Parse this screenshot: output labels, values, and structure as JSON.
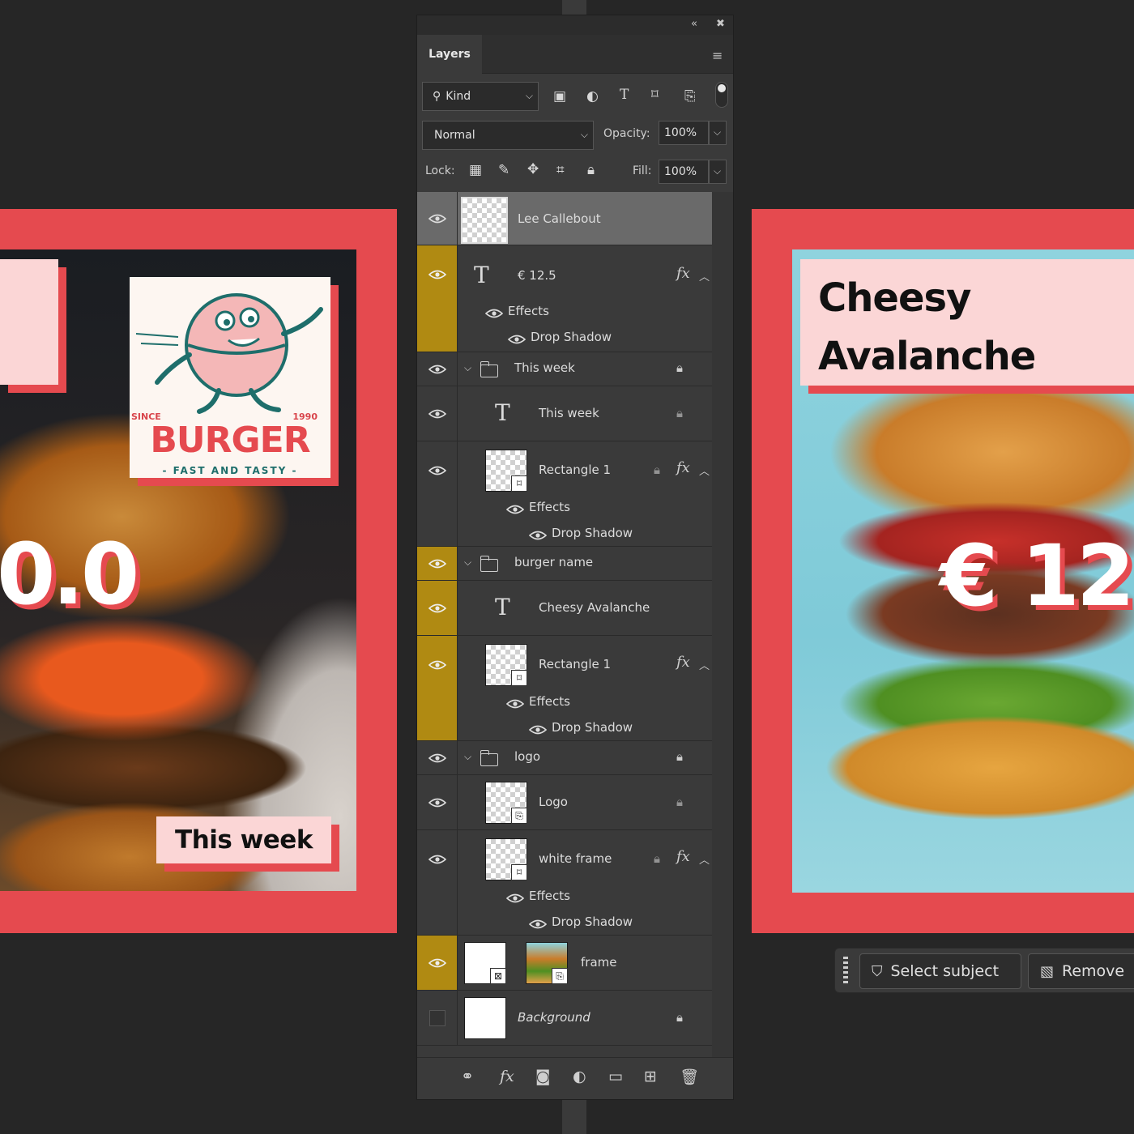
{
  "canvas": {
    "left_artboard": {
      "price_text": "0.0",
      "this_week_label": "This week",
      "logo": {
        "since": "SINCE",
        "year": "1990",
        "title": "BURGER",
        "tagline": "- FAST AND TASTY -"
      }
    },
    "right_artboard": {
      "title_line1": "Cheesy",
      "title_line2": "Avalanche",
      "price_text": "€ 12"
    },
    "colors": {
      "frame_red": "#e54a4f",
      "card_pink": "#fbd6d6",
      "teal_bg": "#8fd3de"
    }
  },
  "panel": {
    "tab_label": "Layers",
    "filter": {
      "value": "Kind"
    },
    "blend_mode": "Normal",
    "opacity_label": "Opacity:",
    "opacity_value": "100%",
    "lock_label": "Lock:",
    "fill_label": "Fill:",
    "fill_value": "100%",
    "filter_icons": [
      "image-filter-icon",
      "adjustment-filter-icon",
      "type-filter-icon",
      "shape-filter-icon",
      "smart-object-filter-icon"
    ],
    "lock_icons": [
      "lock-transparent-icon",
      "lock-paint-icon",
      "lock-position-icon",
      "lock-artboard-icon",
      "lock-all-icon"
    ],
    "layers": {
      "lee_callebout": "Lee Callebout",
      "price": "€ 12.5",
      "price_effects": "Effects",
      "price_drop_shadow": "Drop Shadow",
      "group_this_week": "This week",
      "text_this_week": "This week",
      "rect1_a": "Rectangle 1",
      "rect1_a_effects": "Effects",
      "rect1_a_drop_shadow": "Drop Shadow",
      "group_burger_name": "burger name",
      "text_cheesy": "Cheesy Avalanche",
      "rect1_b": "Rectangle 1",
      "rect1_b_effects": "Effects",
      "rect1_b_drop_shadow": "Drop Shadow",
      "group_logo": "logo",
      "logo": "Logo",
      "white_frame": "white frame",
      "white_frame_effects": "Effects",
      "white_frame_drop_shadow": "Drop Shadow",
      "frame": "frame",
      "background": "Background"
    },
    "highlight_color": "#b08a12",
    "bottom_icons": [
      "link-layers-icon",
      "fx-icon",
      "add-mask-icon",
      "new-adjustment-icon",
      "new-group-icon",
      "new-layer-icon",
      "delete-layer-icon"
    ]
  },
  "task_bar": {
    "select_subject": "Select subject",
    "remove_background": "Remove"
  }
}
